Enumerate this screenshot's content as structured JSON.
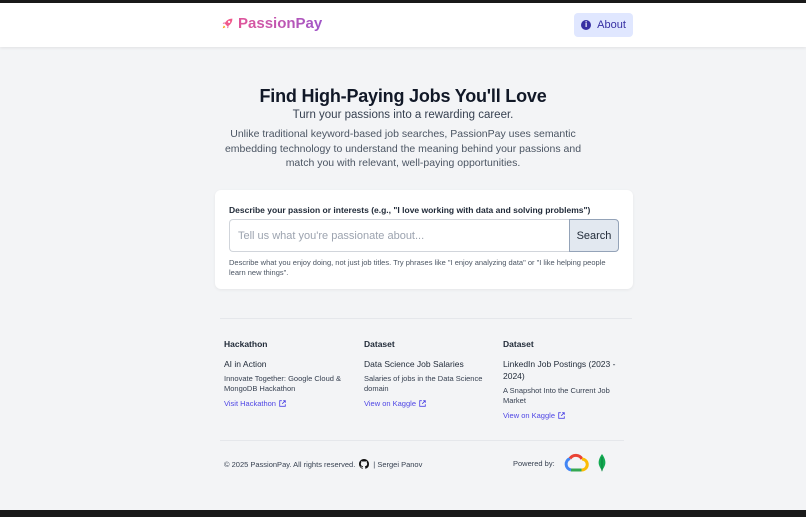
{
  "header": {
    "brand": "PassionPay",
    "about_label": "About"
  },
  "hero": {
    "title": "Find High-Paying Jobs You'll Love",
    "subtitle": "Turn your passions into a rewarding career.",
    "description": "Unlike traditional keyword-based job searches, PassionPay uses semantic embedding technology to understand the meaning behind your passions and match you with relevant, well-paying opportunities."
  },
  "search": {
    "label": "Describe your passion or interests (e.g., \"I love working with data and solving problems\")",
    "placeholder": "Tell us what you're passionate about...",
    "button": "Search",
    "hint": "Describe what you enjoy doing, not just job titles. Try phrases like \"I enjoy analyzing data\" or \"I like helping people learn new things\"."
  },
  "footer": {
    "columns": [
      {
        "heading": "Hackathon",
        "title": "AI in Action",
        "desc": "Innovate Together: Google Cloud & MongoDB Hackathon",
        "link": "Visit Hackathon"
      },
      {
        "heading": "Dataset",
        "title": "Data Science Job Salaries",
        "desc": "Salaries of jobs in the Data Science domain",
        "link": "View on Kaggle"
      },
      {
        "heading": "Dataset",
        "title": "LinkedIn Job Postings (2023 - 2024)",
        "desc": "A Snapshot Into the Current Job Market",
        "link": "View on Kaggle"
      }
    ],
    "copyright": "© 2025 PassionPay. All rights reserved.",
    "author": "| Sergei Panov",
    "powered_by": "Powered by:"
  },
  "icons": {
    "brand": "rocket-icon",
    "about": "info-icon",
    "external": "external-link-icon",
    "github": "github-icon",
    "gcloud": "google-cloud-icon",
    "mongodb": "mongodb-leaf-icon"
  },
  "colors": {
    "accent": "#4f46e5",
    "brand_pink": "#e0569b",
    "about_bg": "#e0e7ff",
    "background": "#f3f4f6"
  }
}
